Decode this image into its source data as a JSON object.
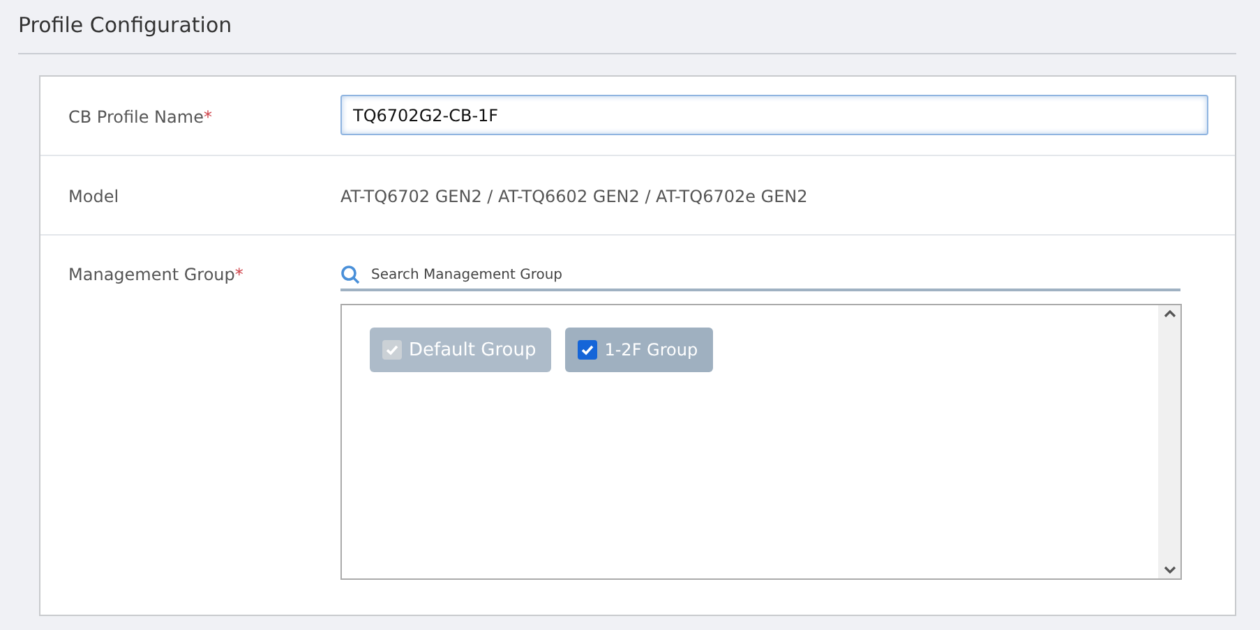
{
  "section_title": "Profile Configuration",
  "fields": [
    {
      "kind": "input",
      "label": "CB Profile Name",
      "required_mark": "*",
      "value": "TQ6702G2-CB-1F"
    },
    {
      "kind": "text",
      "label": "Model",
      "value": "AT-TQ6702 GEN2 / AT-TQ6602 GEN2 / AT-TQ6702e GEN2"
    },
    {
      "kind": "groups",
      "label": "Management Group",
      "required_mark": "*",
      "search_placeholder": "Search Management Group",
      "groups": [
        {
          "label": "Default Group",
          "checked": true,
          "disabled": true
        },
        {
          "label": "1-2F Group",
          "checked": true,
          "disabled": false
        }
      ]
    }
  ]
}
